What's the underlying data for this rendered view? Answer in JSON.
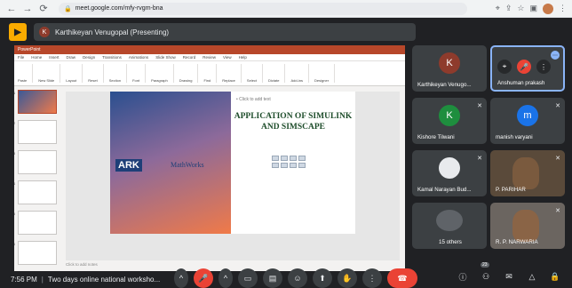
{
  "browser": {
    "url": "meet.google.com/mfy-rvgm-bna",
    "icons": [
      "back-icon",
      "forward-icon",
      "reload-icon",
      "lock-icon",
      "location-icon",
      "share-icon",
      "star-icon",
      "sidebar-icon",
      "profile-icon",
      "menu-icon"
    ]
  },
  "meet": {
    "presenter": "Karthikeyan Venugopal (Presenting)",
    "presenter_initial": "K",
    "time": "7:56 PM",
    "separator": "|",
    "meeting_title": "Two days online national worksho...",
    "people_count": "23",
    "accent": "#8ab4f8",
    "end_color": "#ea4335"
  },
  "ppt": {
    "title_bar": "PowerPoint",
    "menu": [
      "File",
      "Home",
      "Insert",
      "Draw",
      "Design",
      "Transitions",
      "Animations",
      "Slide Show",
      "Record",
      "Review",
      "View",
      "Help"
    ],
    "ribbon": [
      "Paste",
      "New Slide",
      "Layout",
      "Reset",
      "Section",
      "Font",
      "Paragraph",
      "Drawing",
      "Find",
      "Replace",
      "Select",
      "Dictate",
      "Add-ins",
      "Designer"
    ],
    "click_add_text": "• Click to add text",
    "slide_title": "APPLICATION OF SIMULINK AND SIMSCAPE",
    "logo_left": "ARK",
    "logo_right": "MathWorks",
    "notes": "Click to add notes"
  },
  "tiles": [
    {
      "name": "Karthikeyan Venugo...",
      "initial": "K",
      "color": "#8e3b2c"
    },
    {
      "name": "Anshuman prakash",
      "initial": "",
      "color": "#c1502e"
    },
    {
      "name": "Kishore Tilwani",
      "initial": "K",
      "color": "#1e8e3e"
    },
    {
      "name": "manish varyani",
      "initial": "m",
      "color": "#1a73e8"
    },
    {
      "name": "Kamal Narayan Bud...",
      "initial": "",
      "color": "#e8eaed"
    },
    {
      "name": "P. PARIHAR",
      "initial": "",
      "color": ""
    },
    {
      "name": "15 others",
      "initial": "",
      "color": ""
    },
    {
      "name": "R. P. NARWARIA",
      "initial": "",
      "color": ""
    }
  ]
}
